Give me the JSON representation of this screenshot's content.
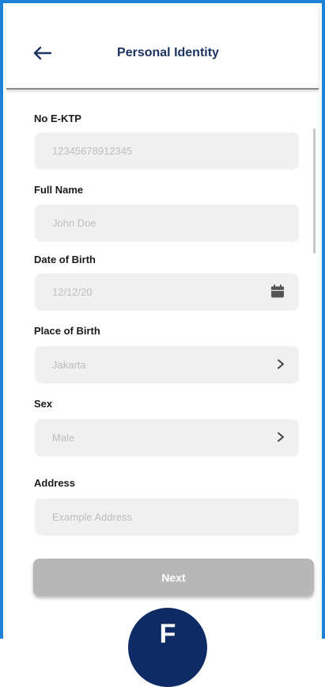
{
  "header": {
    "title": "Personal Identity",
    "back_icon": "arrow-left-icon"
  },
  "form": {
    "ktp": {
      "label": "No E-KTP",
      "placeholder": "12345678912345"
    },
    "full_name": {
      "label": "Full Name",
      "placeholder": "John Doe"
    },
    "date_of_birth": {
      "label": "Date of Birth",
      "value": "12/12/20",
      "icon": "calendar-icon"
    },
    "place_of_birth": {
      "label": "Place of Birth",
      "value": "Jakarta",
      "icon": "chevron-right-icon"
    },
    "sex": {
      "label": "Sex",
      "value": "Male",
      "icon": "chevron-right-icon"
    },
    "address": {
      "label": "Address",
      "placeholder": "Example Address"
    }
  },
  "next_label": "Next",
  "step_badge": "F",
  "colors": {
    "accent_border": "#1e82d6",
    "title": "#1c3461",
    "field_bg": "#f0f0f0",
    "button_disabled": "#b7b7b7",
    "badge": "#0f2b66"
  }
}
